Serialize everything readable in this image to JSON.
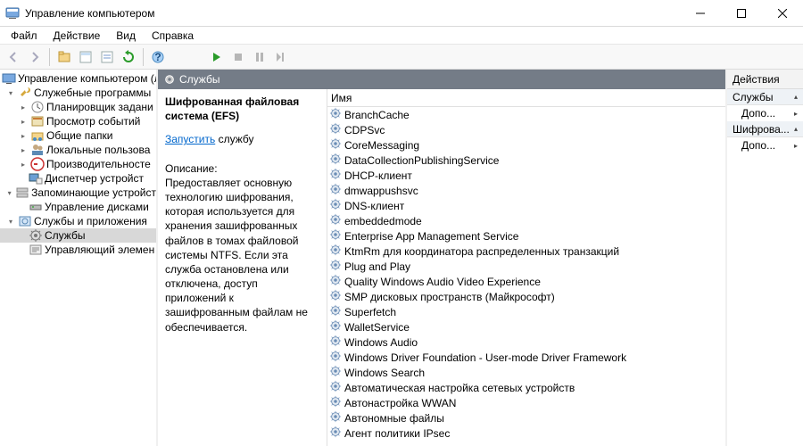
{
  "window": {
    "title": "Управление компьютером"
  },
  "menu": {
    "file": "Файл",
    "action": "Действие",
    "view": "Вид",
    "help": "Справка"
  },
  "tree": {
    "root": "Управление компьютером (л",
    "group1": "Служебные программы",
    "g1_items": {
      "scheduler": "Планировщик задани",
      "eventviewer": "Просмотр событий",
      "shared": "Общие папки",
      "users": "Локальные пользова",
      "perf": "Производительносте",
      "devmgr": "Диспетчер устройст"
    },
    "group2": "Запоминающие устройст",
    "g2_items": {
      "diskmgmt": "Управление дисками"
    },
    "group3": "Службы и приложения",
    "g3_items": {
      "services": "Службы",
      "wmi": "Управляющий элемен"
    }
  },
  "services_panel": {
    "header": "Службы",
    "selected_name": "Шифрованная файловая система (EFS)",
    "start_link": "Запустить",
    "start_suffix": " службу",
    "description_label": "Описание:",
    "description": "Предоставляет основную технологию шифрования, которая используется для хранения зашифрованных файлов в томах файловой системы NTFS. Если эта служба остановлена или отключена, доступ приложений к зашифрованным файлам не обеспечивается.",
    "name_column": "Имя",
    "items": [
      "BranchCache",
      "CDPSvc",
      "CoreMessaging",
      "DataCollectionPublishingService",
      "DHCP-клиент",
      "dmwappushsvc",
      "DNS-клиент",
      "embeddedmode",
      "Enterprise App Management Service",
      "KtmRm для координатора распределенных транзакций",
      "Plug and Play",
      "Quality Windows Audio Video Experience",
      "SMP дисковых пространств (Майкрософт)",
      "Superfetch",
      "WalletService",
      "Windows Audio",
      "Windows Driver Foundation - User-mode Driver Framework",
      "Windows Search",
      "Автоматическая настройка сетевых устройств",
      "Автонастройка WWAN",
      "Автономные файлы",
      "Агент политики IPsec"
    ]
  },
  "actions": {
    "header": "Действия",
    "group1": "Службы",
    "more": "Допо...",
    "group2": "Шифрова..."
  }
}
